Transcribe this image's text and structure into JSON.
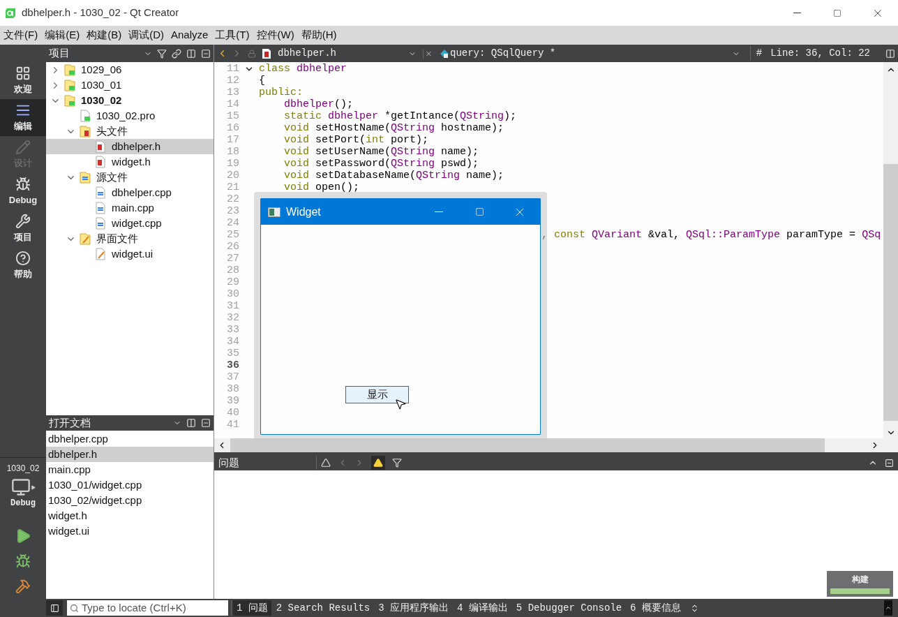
{
  "window": {
    "title": "dbhelper.h - 1030_02 - Qt Creator"
  },
  "menu": [
    "文件(F)",
    "编辑(E)",
    "构建(B)",
    "调试(D)",
    "Analyze",
    "工具(T)",
    "控件(W)",
    "帮助(H)"
  ],
  "modes": [
    {
      "label": "欢迎",
      "selected": false,
      "disabled": false
    },
    {
      "label": "编辑",
      "selected": true,
      "disabled": false
    },
    {
      "label": "设计",
      "selected": false,
      "disabled": true
    },
    {
      "label": "Debug",
      "selected": false,
      "disabled": false
    },
    {
      "label": "项目",
      "selected": false,
      "disabled": false
    },
    {
      "label": "帮助",
      "selected": false,
      "disabled": false
    }
  ],
  "kit": {
    "project": "1030_02",
    "build": "Debug"
  },
  "projects": {
    "title": "项目",
    "tree": [
      {
        "label": "1029_06",
        "kind": "project",
        "expanded": false,
        "active": false,
        "selected": false
      },
      {
        "label": "1030_01",
        "kind": "project",
        "expanded": false,
        "active": false,
        "selected": false
      },
      {
        "label": "1030_02",
        "kind": "project",
        "expanded": true,
        "active": true,
        "selected": false,
        "children": [
          {
            "label": "1030_02.pro",
            "kind": "pro",
            "selected": false
          },
          {
            "label": "头文件",
            "kind": "headers",
            "expanded": true,
            "selected": false,
            "children": [
              {
                "label": "dbhelper.h",
                "kind": "header",
                "selected": true
              },
              {
                "label": "widget.h",
                "kind": "header",
                "selected": false
              }
            ]
          },
          {
            "label": "源文件",
            "kind": "sources",
            "expanded": true,
            "selected": false,
            "children": [
              {
                "label": "dbhelper.cpp",
                "kind": "source",
                "selected": false
              },
              {
                "label": "main.cpp",
                "kind": "source",
                "selected": false
              },
              {
                "label": "widget.cpp",
                "kind": "source",
                "selected": false
              }
            ]
          },
          {
            "label": "界面文件",
            "kind": "forms",
            "expanded": true,
            "selected": false,
            "children": [
              {
                "label": "widget.ui",
                "kind": "form",
                "selected": false
              }
            ]
          }
        ]
      }
    ]
  },
  "open_documents": {
    "title": "打开文档",
    "items": [
      {
        "label": "dbhelper.cpp",
        "selected": false
      },
      {
        "label": "dbhelper.h",
        "selected": true
      },
      {
        "label": "main.cpp",
        "selected": false
      },
      {
        "label": "1030_01/widget.cpp",
        "selected": false
      },
      {
        "label": "1030_02/widget.cpp",
        "selected": false
      },
      {
        "label": "widget.h",
        "selected": false
      },
      {
        "label": "widget.ui",
        "selected": false
      }
    ]
  },
  "editor": {
    "file": "dbhelper.h",
    "symbol": "query: QSqlQuery *",
    "hash": "#",
    "position": "Line: 36, Col: 22",
    "lines": [
      {
        "n": "11",
        "current": false,
        "fold": true,
        "covered": false,
        "tokens": [
          {
            "t": "class ",
            "kind": "keyword"
          },
          {
            "t": "dbhelper",
            "kind": "type"
          }
        ]
      },
      {
        "n": "12",
        "current": false,
        "fold": false,
        "covered": false,
        "tokens": [
          {
            "t": "{",
            "kind": "plain"
          }
        ]
      },
      {
        "n": "13",
        "current": false,
        "fold": false,
        "covered": false,
        "tokens": [
          {
            "t": "public:",
            "kind": "keyword"
          }
        ]
      },
      {
        "n": "14",
        "current": false,
        "fold": false,
        "covered": false,
        "tokens": [
          {
            "t": "    dbhelper",
            "kind": "type"
          },
          {
            "t": "();",
            "kind": "plain"
          }
        ]
      },
      {
        "n": "15",
        "current": false,
        "fold": false,
        "covered": false,
        "tokens": [
          {
            "t": "    static ",
            "kind": "keyword"
          },
          {
            "t": "dbhelper",
            "kind": "type"
          },
          {
            "t": " *getIntance(",
            "kind": "plain"
          },
          {
            "t": "QString",
            "kind": "type"
          },
          {
            "t": ");",
            "kind": "plain"
          }
        ]
      },
      {
        "n": "16",
        "current": false,
        "fold": false,
        "covered": false,
        "tokens": [
          {
            "t": "    void",
            "kind": "keyword"
          },
          {
            "t": " setHostName(",
            "kind": "plain"
          },
          {
            "t": "QString",
            "kind": "type"
          },
          {
            "t": " hostname);",
            "kind": "plain"
          }
        ]
      },
      {
        "n": "17",
        "current": false,
        "fold": false,
        "covered": false,
        "tokens": [
          {
            "t": "    void",
            "kind": "keyword"
          },
          {
            "t": " setPort(",
            "kind": "plain"
          },
          {
            "t": "int",
            "kind": "keyword"
          },
          {
            "t": " port);",
            "kind": "plain"
          }
        ]
      },
      {
        "n": "18",
        "current": false,
        "fold": false,
        "covered": false,
        "tokens": [
          {
            "t": "    void",
            "kind": "keyword"
          },
          {
            "t": " setUserName(",
            "kind": "plain"
          },
          {
            "t": "QString",
            "kind": "type"
          },
          {
            "t": " name);",
            "kind": "plain"
          }
        ]
      },
      {
        "n": "19",
        "current": false,
        "fold": false,
        "covered": false,
        "tokens": [
          {
            "t": "    void",
            "kind": "keyword"
          },
          {
            "t": " setPassword(",
            "kind": "plain"
          },
          {
            "t": "QString",
            "kind": "type"
          },
          {
            "t": " pswd);",
            "kind": "plain"
          }
        ]
      },
      {
        "n": "20",
        "current": false,
        "fold": false,
        "covered": false,
        "tokens": [
          {
            "t": "    void",
            "kind": "keyword"
          },
          {
            "t": " setDatabaseName(",
            "kind": "plain"
          },
          {
            "t": "QString",
            "kind": "type"
          },
          {
            "t": " name);",
            "kind": "plain"
          }
        ]
      },
      {
        "n": "21",
        "current": false,
        "fold": false,
        "covered": false,
        "tokens": [
          {
            "t": "    void",
            "kind": "keyword"
          },
          {
            "t": " open();",
            "kind": "plain"
          }
        ]
      },
      {
        "n": "22",
        "current": false,
        "fold": false
      },
      {
        "n": "23",
        "current": false,
        "fold": false
      },
      {
        "n": "24",
        "current": false,
        "fold": false
      },
      {
        "n": "25",
        "current": false,
        "fold": false,
        "covered": true,
        "tokens": [
          {
            "t": ", ",
            "kind": "plain"
          },
          {
            "t": "const ",
            "kind": "keyword"
          },
          {
            "t": "QVariant",
            "kind": "type"
          },
          {
            "t": " &val, ",
            "kind": "plain"
          },
          {
            "t": "QSql::ParamType",
            "kind": "type"
          },
          {
            "t": " paramType = ",
            "kind": "plain"
          },
          {
            "t": "QSq",
            "kind": "type"
          }
        ]
      },
      {
        "n": "26",
        "current": false,
        "fold": false
      },
      {
        "n": "27",
        "current": false,
        "fold": false
      },
      {
        "n": "28",
        "current": false,
        "fold": false
      },
      {
        "n": "29",
        "current": false,
        "fold": false
      },
      {
        "n": "30",
        "current": false,
        "fold": false
      },
      {
        "n": "31",
        "current": false,
        "fold": false
      },
      {
        "n": "32",
        "current": false,
        "fold": false
      },
      {
        "n": "33",
        "current": false,
        "fold": false
      },
      {
        "n": "34",
        "current": false,
        "fold": false
      },
      {
        "n": "35",
        "current": false,
        "fold": false
      },
      {
        "n": "36",
        "current": true,
        "fold": false
      },
      {
        "n": "37",
        "current": false,
        "fold": false
      },
      {
        "n": "38",
        "current": false,
        "fold": false
      },
      {
        "n": "39",
        "current": false,
        "fold": false
      },
      {
        "n": "40",
        "current": false,
        "fold": false
      },
      {
        "n": "41",
        "current": false,
        "fold": false
      }
    ]
  },
  "widget": {
    "title": "Widget",
    "button": "显示"
  },
  "issues": {
    "title": "问题"
  },
  "build": {
    "label": "构建",
    "level": 1
  },
  "locator": {
    "placeholder": "Type to locate (Ctrl+K)"
  },
  "output_tabs": [
    {
      "number": "1",
      "label": "问题",
      "selected": true
    },
    {
      "number": "2",
      "label": "Search Results",
      "selected": false
    },
    {
      "number": "3",
      "label": "应用程序输出",
      "selected": false
    },
    {
      "number": "4",
      "label": "编译输出",
      "selected": false
    },
    {
      "number": "5",
      "label": "Debugger Console",
      "selected": false
    },
    {
      "number": "6",
      "label": "概要信息",
      "selected": false
    }
  ]
}
